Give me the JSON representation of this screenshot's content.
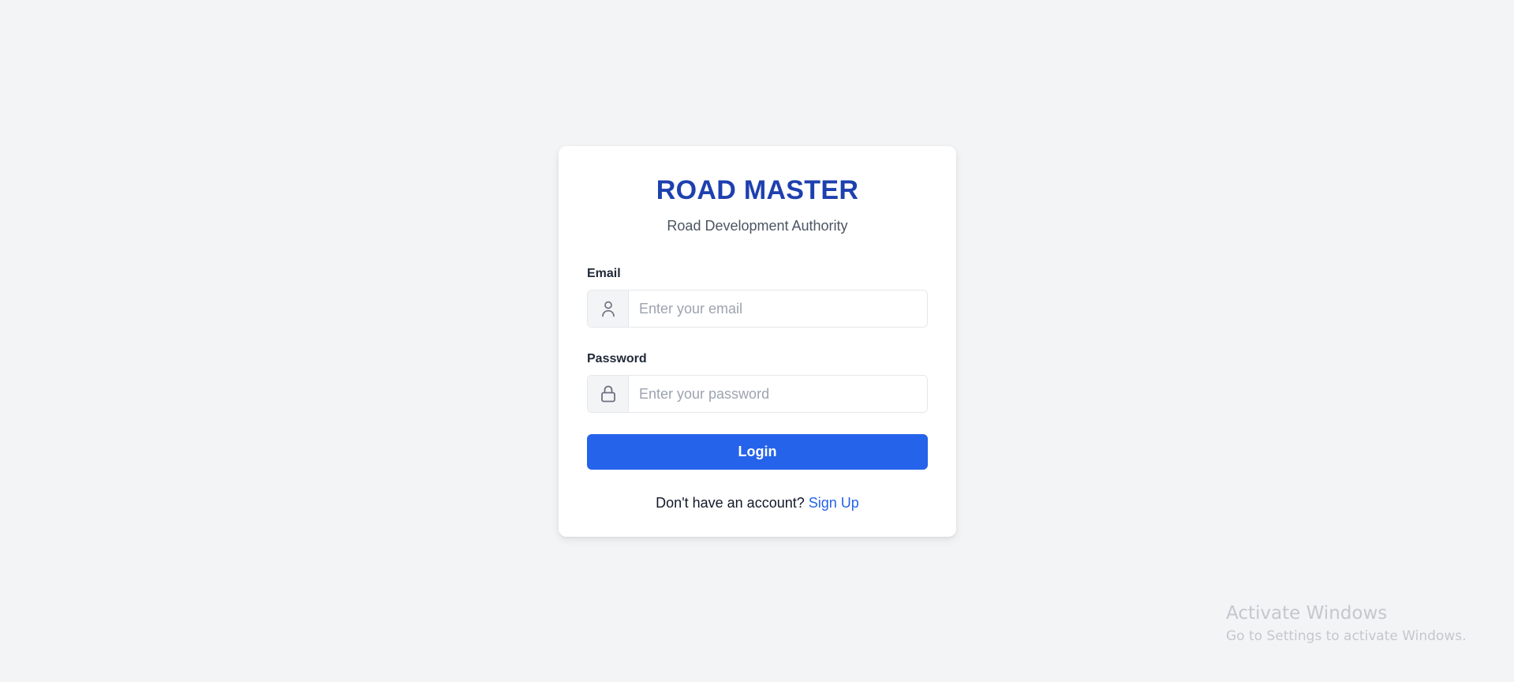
{
  "app": {
    "title": "ROAD MASTER",
    "subtitle": "Road Development Authority"
  },
  "form": {
    "email": {
      "label": "Email",
      "placeholder": "Enter your email",
      "value": "",
      "icon": "user-icon"
    },
    "password": {
      "label": "Password",
      "placeholder": "Enter your password",
      "value": "",
      "icon": "lock-icon"
    },
    "login_label": "Login",
    "signup_prompt": "Don't have an account?",
    "signup_link": "Sign Up"
  },
  "watermark": {
    "title": "Activate Windows",
    "subtitle": "Go to Settings to activate Windows."
  },
  "colors": {
    "brand": "#1e40af",
    "accent": "#2563eb",
    "background": "#f3f4f6",
    "card": "#ffffff"
  }
}
